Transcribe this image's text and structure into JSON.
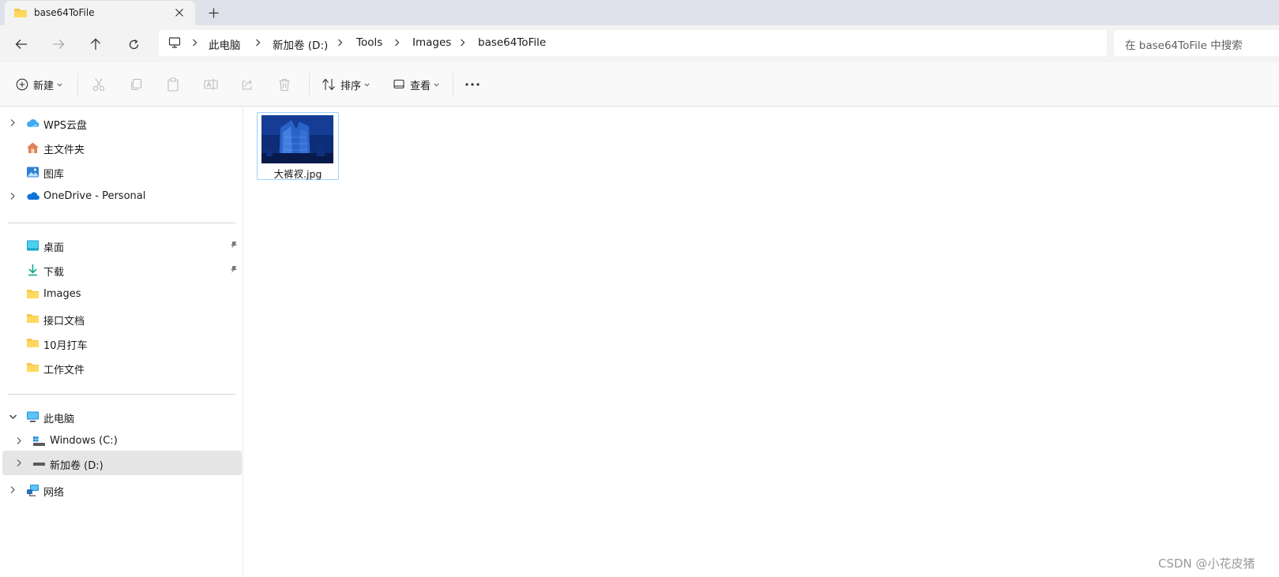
{
  "window": {
    "tab_title": "base64ToFile",
    "tab_close_icon": "close-icon",
    "new_tab_icon": "plus-icon"
  },
  "address": {
    "breadcrumbs": [
      "此电脑",
      "新加卷 (D:)",
      "Tools",
      "Images",
      "base64ToFile"
    ],
    "search_placeholder": "在 base64ToFile 中搜索"
  },
  "toolbar": {
    "new_label": "新建",
    "sort_label": "排序",
    "view_label": "查看",
    "icons": [
      "cut-icon",
      "copy-icon",
      "paste-icon",
      "rename-icon",
      "share-icon",
      "delete-icon",
      "more-icon"
    ]
  },
  "sidebar": {
    "quick": [
      {
        "label": "WPS云盘",
        "icon": "wps-cloud-icon",
        "expandable": true
      },
      {
        "label": "主文件夹",
        "icon": "home-icon",
        "expandable": false
      },
      {
        "label": "图库",
        "icon": "gallery-icon",
        "expandable": false
      },
      {
        "label": "OneDrive - Personal",
        "icon": "onedrive-icon",
        "expandable": true
      }
    ],
    "pinned": [
      {
        "label": "桌面",
        "icon": "desktop-icon",
        "pinned": true
      },
      {
        "label": "下载",
        "icon": "download-icon",
        "pinned": true
      },
      {
        "label": "Images",
        "icon": "folder-icon",
        "pinned": false
      },
      {
        "label": "接口文档",
        "icon": "folder-icon",
        "pinned": false
      },
      {
        "label": "10月打车",
        "icon": "folder-icon",
        "pinned": false
      },
      {
        "label": "工作文件",
        "icon": "folder-icon",
        "pinned": false
      }
    ],
    "thispc": {
      "label": "此电脑",
      "icon": "this-pc-icon",
      "expanded": true
    },
    "drives": [
      {
        "label": "Windows (C:)",
        "icon": "drive-icon"
      },
      {
        "label": "新加卷 (D:)",
        "icon": "drive-icon",
        "selected": true
      }
    ],
    "network": {
      "label": "网络",
      "icon": "network-icon"
    }
  },
  "files": [
    {
      "name": "大裤衩.jpg",
      "icon": "image-thumbnail"
    }
  ],
  "watermark": "CSDN @小花皮猪",
  "colors": {
    "tabstrip_bg": "#dfe2ea",
    "chrome_bg": "#f3f3f3",
    "selection_border": "#99d1ff",
    "selected_nav_bg": "#e5e5e5",
    "folder_yellow": "#f6c64b"
  }
}
